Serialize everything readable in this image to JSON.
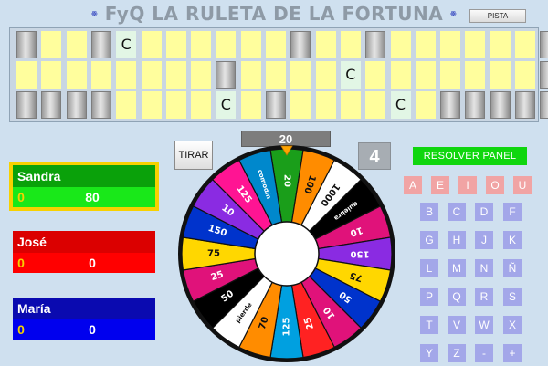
{
  "title": "FyQ LA RULETA DE LA FORTUNA",
  "buttons": {
    "pista": "PISTA",
    "tirar": "TIRAR",
    "resolver": "RESOLVER PANEL"
  },
  "spin_value": "20",
  "counter": "4",
  "board": {
    "rows": [
      [
        "gray",
        "yellow",
        "yellow",
        "gray",
        "C",
        "yellow",
        "yellow",
        "yellow",
        "yellow",
        "yellow",
        "yellow",
        "gray",
        "yellow",
        "yellow",
        "gray",
        "yellow",
        "yellow",
        "yellow",
        "yellow",
        "yellow",
        "yellow",
        "gray"
      ],
      [
        "yellow",
        "yellow",
        "yellow",
        "yellow",
        "yellow",
        "yellow",
        "yellow",
        "yellow",
        "gray",
        "yellow",
        "yellow",
        "yellow",
        "yellow",
        "C",
        "yellow",
        "yellow",
        "yellow",
        "yellow",
        "yellow",
        "yellow",
        "yellow",
        "gray"
      ],
      [
        "gray",
        "gray",
        "gray",
        "gray",
        "yellow",
        "yellow",
        "yellow",
        "yellow",
        "C",
        "yellow",
        "gray",
        "yellow",
        "yellow",
        "yellow",
        "yellow",
        "C",
        "yellow",
        "gray",
        "gray",
        "gray",
        "gray",
        "gray"
      ]
    ]
  },
  "players": [
    {
      "name": "Sandra",
      "score_small": "0",
      "score": "80"
    },
    {
      "name": "José",
      "score_small": "0",
      "score": "0"
    },
    {
      "name": "María",
      "score_small": "0",
      "score": "0"
    }
  ],
  "vowels": [
    "A",
    "E",
    "I",
    "O",
    "U"
  ],
  "consonants": [
    "B",
    "C",
    "D",
    "F",
    "G",
    "H",
    "J",
    "K",
    "L",
    "M",
    "N",
    "Ñ",
    "P",
    "Q",
    "R",
    "S",
    "T",
    "V",
    "W",
    "X",
    "Y",
    "Z",
    "-",
    "+"
  ],
  "wheel": {
    "segment_colors": [
      "#1a9e1a",
      "#ff8c00",
      "#ffffff",
      "#000000",
      "#e0127a",
      "#8a2be2",
      "#ffd700",
      "#0033cc",
      "#e0127a",
      "#ff2222",
      "#00a0e0",
      "#ff8c00",
      "#ffffff",
      "#000000",
      "#e0127a",
      "#ffd700",
      "#0033cc",
      "#8a2be2",
      "#ff1493",
      "#0088cc"
    ],
    "segment_labels": [
      "20",
      "100",
      "1000",
      "quiebra",
      "10",
      "150",
      "75",
      "50",
      "10",
      "25",
      "125",
      "70",
      "pierde",
      "50",
      "25",
      "75",
      "150",
      "10",
      "125",
      "comodín"
    ]
  },
  "icons": {
    "title": "atom-icon",
    "pointer": "triangle-down-icon"
  }
}
